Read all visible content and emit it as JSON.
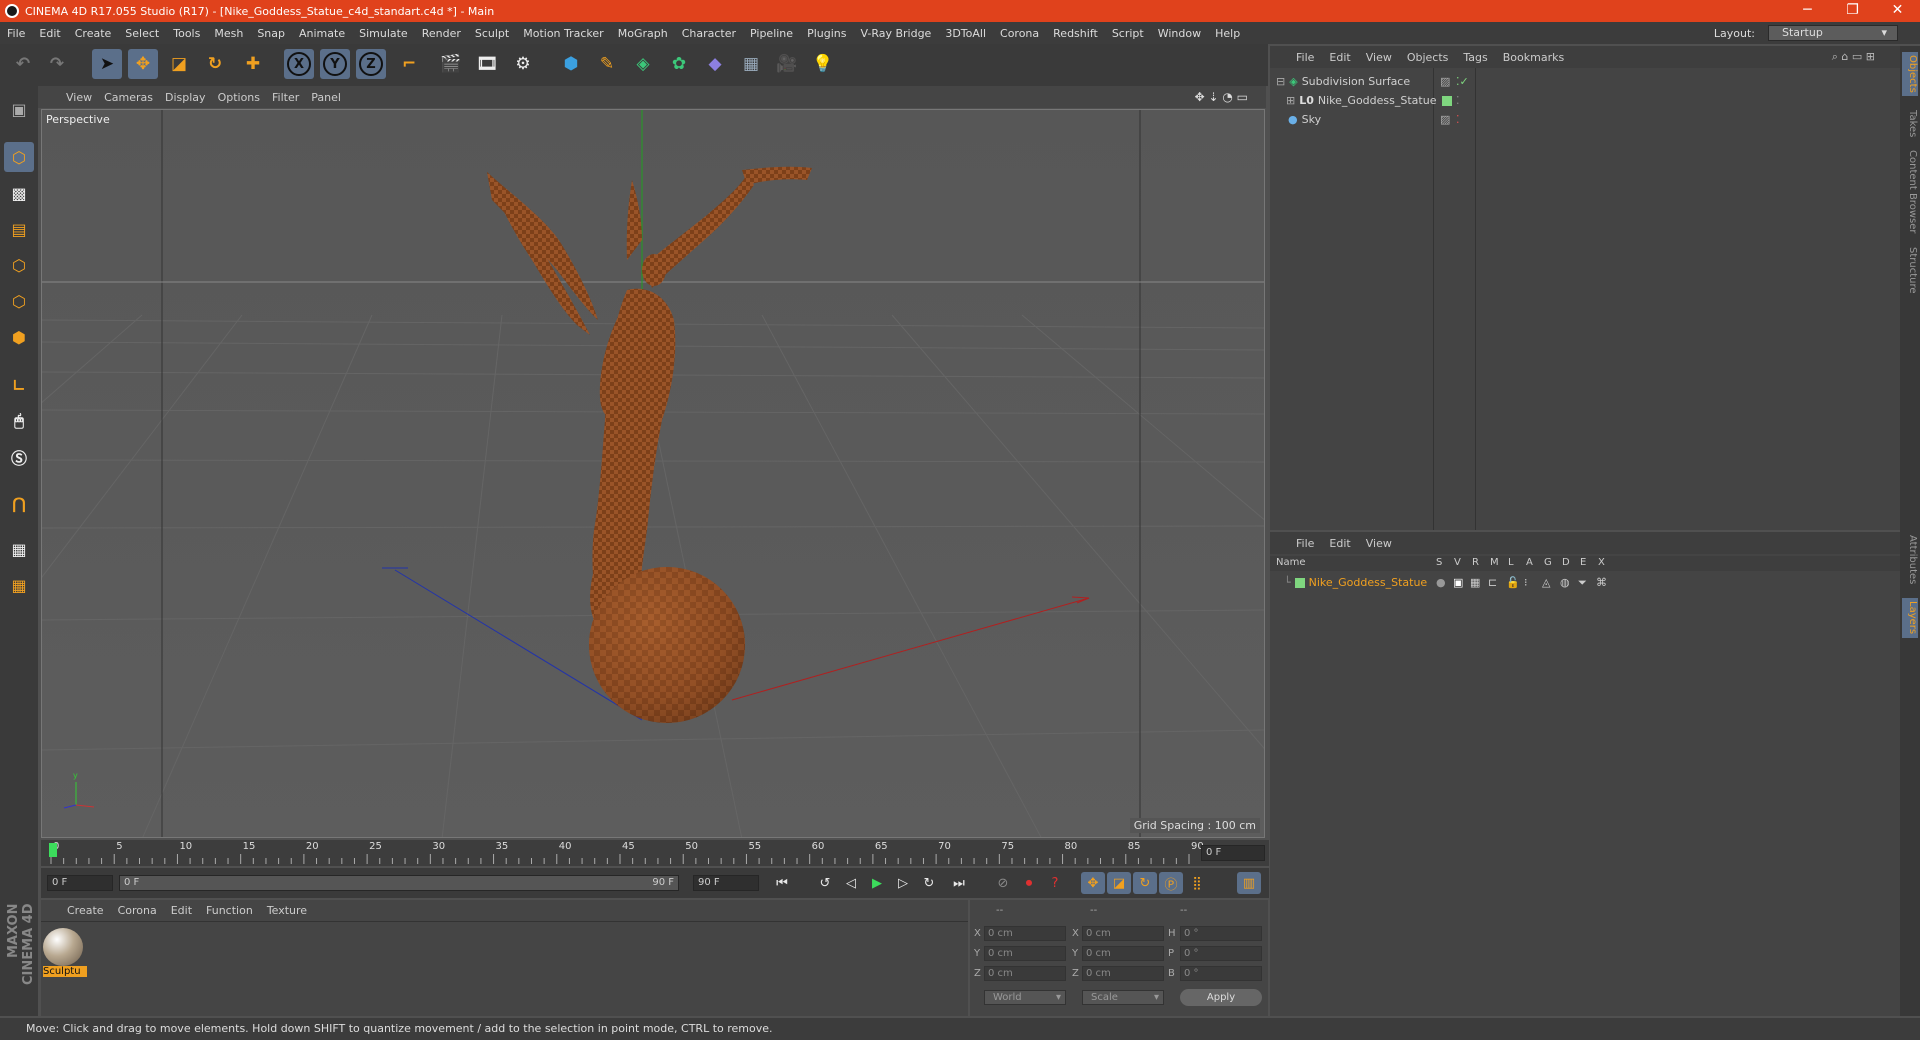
{
  "window": {
    "title": "CINEMA 4D R17.055 Studio (R17) - [Nike_Goddess_Statue_c4d_standart.c4d *] - Main",
    "minimize": "─",
    "restore": "❐",
    "close": "✕"
  },
  "menu": [
    "File",
    "Edit",
    "Create",
    "Select",
    "Tools",
    "Mesh",
    "Snap",
    "Animate",
    "Simulate",
    "Render",
    "Sculpt",
    "Motion Tracker",
    "MoGraph",
    "Character",
    "Pipeline",
    "Plugins",
    "V-Ray Bridge",
    "3DToAll",
    "Corona",
    "Redshift",
    "Script",
    "Window",
    "Help"
  ],
  "layout": {
    "label": "Layout:",
    "value": "Startup"
  },
  "toolbar_icons": [
    "undo-icon",
    "redo-icon",
    "select-arrow-icon",
    "move-icon",
    "scale-icon",
    "rotate-icon",
    "live-select-icon",
    "x-axis-icon",
    "y-axis-icon",
    "z-axis-icon",
    "world-coordinates-icon",
    "render-view-icon",
    "render-picture-viewer-icon",
    "render-settings-icon",
    "cube-icon",
    "pen-icon",
    "subdivision-icon",
    "cloner-icon",
    "deformer-icon",
    "floor-icon",
    "camera-icon",
    "light-icon"
  ],
  "axis": {
    "x": "X",
    "y": "Y",
    "z": "Z"
  },
  "viewport": {
    "menu": [
      "View",
      "Cameras",
      "Display",
      "Options",
      "Filter",
      "Panel"
    ],
    "label": "Perspective",
    "grid_spacing": "Grid Spacing : 100 cm",
    "nav_icons": "✥ ⇣ ◔ ▭"
  },
  "timeline": {
    "ticks": [
      "0",
      "5",
      "10",
      "15",
      "20",
      "25",
      "30",
      "35",
      "40",
      "45",
      "50",
      "55",
      "60",
      "65",
      "70",
      "75",
      "80",
      "85",
      "90"
    ],
    "current_frame": "0 F",
    "start": "0 F",
    "range_start": "0 F",
    "range_end": "90 F",
    "end": "90 F"
  },
  "material_panel": {
    "menu": [
      "Create",
      "Corona",
      "Edit",
      "Function",
      "Texture"
    ],
    "material_name": "Sculptu"
  },
  "coordinates": {
    "headers": [
      "--",
      "--",
      "--"
    ],
    "rows": [
      {
        "l1": "X",
        "v1": "0 cm",
        "l2": "X",
        "v2": "0 cm",
        "l3": "H",
        "v3": "0 °"
      },
      {
        "l1": "Y",
        "v1": "0 cm",
        "l2": "Y",
        "v2": "0 cm",
        "l3": "P",
        "v3": "0 °"
      },
      {
        "l1": "Z",
        "v1": "0 cm",
        "l2": "Z",
        "v2": "0 cm",
        "l3": "B",
        "v3": "0 °"
      }
    ],
    "mode": "World",
    "scale_mode": "Scale",
    "apply": "Apply"
  },
  "object_manager": {
    "menu": [
      "File",
      "Edit",
      "View",
      "Objects",
      "Tags",
      "Bookmarks"
    ],
    "objects": [
      {
        "name": "Subdivision Surface",
        "icon": "subdivision-icon",
        "tag_color": "#7fd67f"
      },
      {
        "name": "Nike_Goddess_Statue",
        "icon": "null-object-icon",
        "tag_color": "#7fd67f"
      },
      {
        "name": "Sky",
        "icon": "sky-icon",
        "tag_color": ""
      }
    ]
  },
  "layer_manager": {
    "menu": [
      "File",
      "Edit",
      "View"
    ],
    "columns": [
      "Name",
      "S",
      "V",
      "R",
      "M",
      "L",
      "A",
      "G",
      "D",
      "E",
      "X"
    ],
    "layer_name": "Nike_Goddess_Statue",
    "layer_color": "#7fd67f"
  },
  "right_tabs": [
    "Objects",
    "Takes",
    "Content Browser",
    "Structure",
    "Attributes",
    "Layers"
  ],
  "branding": "MAXON CINEMA 4D",
  "status": "Move: Click and drag to move elements. Hold down SHIFT to quantize movement / add to the selection in point mode, CTRL to remove.",
  "colors": {
    "title_bar": "#e0421c",
    "accent_orange": "#f0a020",
    "selection_blue": "#5b6f8a"
  }
}
